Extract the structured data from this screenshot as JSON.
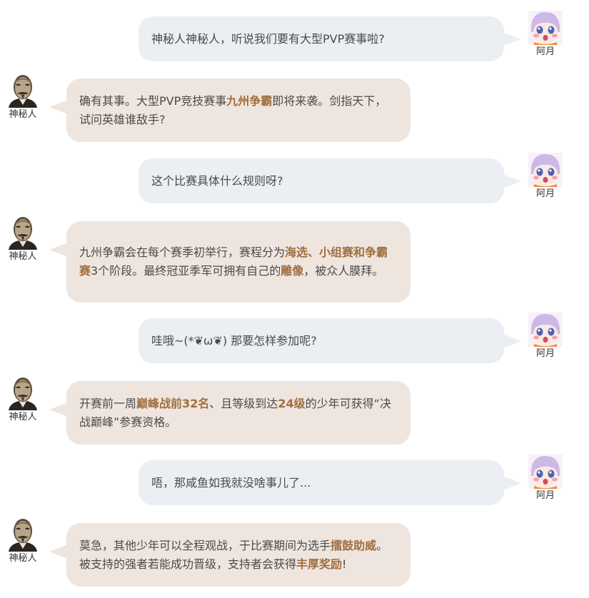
{
  "characters": {
    "ayue": {
      "name": "阿月"
    },
    "mystery": {
      "name": "神秘人"
    }
  },
  "colors": {
    "highlight": "#a06e3f",
    "right_bubble": "#ebeef2",
    "left_bubble": "#efe5df"
  },
  "messages": [
    {
      "speaker": "阿月",
      "segments": [
        {
          "t": "神秘人神秘人，听说我们要有大型PVP赛事啦?"
        }
      ]
    },
    {
      "speaker": "神秘人",
      "segments": [
        {
          "t": "确有其事。大型PVP竞技赛事"
        },
        {
          "t": "九州争霸",
          "hl": true
        },
        {
          "t": "即将来袭。剑指天下，试问英雄谁敌手?"
        }
      ]
    },
    {
      "speaker": "阿月",
      "segments": [
        {
          "t": "这个比赛具体什么规则呀?"
        }
      ]
    },
    {
      "speaker": "神秘人",
      "segments": [
        {
          "t": "九州争霸会在每个赛季初举行，赛程分为"
        },
        {
          "t": "海选、小组赛和争霸赛",
          "hl": true
        },
        {
          "t": "3个阶段。最终冠亚季军可拥有自己的"
        },
        {
          "t": "雕像",
          "hl": true
        },
        {
          "t": "，被众人膜拜。"
        }
      ]
    },
    {
      "speaker": "阿月",
      "segments": [
        {
          "t": "哇哦~(*❦ω❦) 那要怎样参加呢?"
        }
      ]
    },
    {
      "speaker": "神秘人",
      "segments": [
        {
          "t": "开赛前一周"
        },
        {
          "t": "巅峰战前32名",
          "hl": true
        },
        {
          "t": "、且等级到达"
        },
        {
          "t": "24级",
          "hl": true
        },
        {
          "t": "的少年可获得“决战巅峰”参赛资格。"
        }
      ]
    },
    {
      "speaker": "阿月",
      "segments": [
        {
          "t": "唔，那咸鱼如我就没啥事儿了..."
        }
      ]
    },
    {
      "speaker": "神秘人",
      "segments": [
        {
          "t": "莫急，其他少年可以全程观战，于比赛期间为选手"
        },
        {
          "t": "擂鼓助威",
          "hl": true
        },
        {
          "t": "。被支持的强者若能成功晋级，支持者会获得"
        },
        {
          "t": "丰厚奖励",
          "hl": true
        },
        {
          "t": "!"
        }
      ]
    }
  ]
}
